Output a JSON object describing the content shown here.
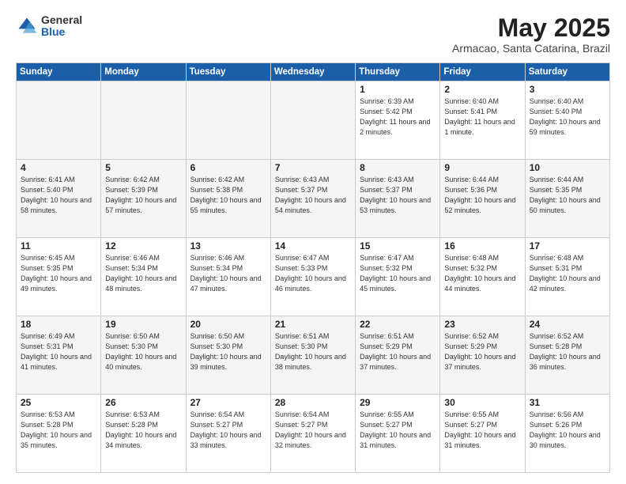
{
  "header": {
    "logo_general": "General",
    "logo_blue": "Blue",
    "month_year": "May 2025",
    "location": "Armacao, Santa Catarina, Brazil"
  },
  "days_of_week": [
    "Sunday",
    "Monday",
    "Tuesday",
    "Wednesday",
    "Thursday",
    "Friday",
    "Saturday"
  ],
  "weeks": [
    [
      {
        "day": "",
        "empty": true
      },
      {
        "day": "",
        "empty": true
      },
      {
        "day": "",
        "empty": true
      },
      {
        "day": "",
        "empty": true
      },
      {
        "day": "1",
        "sunrise": "6:39 AM",
        "sunset": "5:42 PM",
        "daylight": "11 hours and 2 minutes."
      },
      {
        "day": "2",
        "sunrise": "6:40 AM",
        "sunset": "5:41 PM",
        "daylight": "11 hours and 1 minute."
      },
      {
        "day": "3",
        "sunrise": "6:40 AM",
        "sunset": "5:40 PM",
        "daylight": "10 hours and 59 minutes."
      }
    ],
    [
      {
        "day": "4",
        "sunrise": "6:41 AM",
        "sunset": "5:40 PM",
        "daylight": "10 hours and 58 minutes."
      },
      {
        "day": "5",
        "sunrise": "6:42 AM",
        "sunset": "5:39 PM",
        "daylight": "10 hours and 57 minutes."
      },
      {
        "day": "6",
        "sunrise": "6:42 AM",
        "sunset": "5:38 PM",
        "daylight": "10 hours and 55 minutes."
      },
      {
        "day": "7",
        "sunrise": "6:43 AM",
        "sunset": "5:37 PM",
        "daylight": "10 hours and 54 minutes."
      },
      {
        "day": "8",
        "sunrise": "6:43 AM",
        "sunset": "5:37 PM",
        "daylight": "10 hours and 53 minutes."
      },
      {
        "day": "9",
        "sunrise": "6:44 AM",
        "sunset": "5:36 PM",
        "daylight": "10 hours and 52 minutes."
      },
      {
        "day": "10",
        "sunrise": "6:44 AM",
        "sunset": "5:35 PM",
        "daylight": "10 hours and 50 minutes."
      }
    ],
    [
      {
        "day": "11",
        "sunrise": "6:45 AM",
        "sunset": "5:35 PM",
        "daylight": "10 hours and 49 minutes."
      },
      {
        "day": "12",
        "sunrise": "6:46 AM",
        "sunset": "5:34 PM",
        "daylight": "10 hours and 48 minutes."
      },
      {
        "day": "13",
        "sunrise": "6:46 AM",
        "sunset": "5:34 PM",
        "daylight": "10 hours and 47 minutes."
      },
      {
        "day": "14",
        "sunrise": "6:47 AM",
        "sunset": "5:33 PM",
        "daylight": "10 hours and 46 minutes."
      },
      {
        "day": "15",
        "sunrise": "6:47 AM",
        "sunset": "5:32 PM",
        "daylight": "10 hours and 45 minutes."
      },
      {
        "day": "16",
        "sunrise": "6:48 AM",
        "sunset": "5:32 PM",
        "daylight": "10 hours and 44 minutes."
      },
      {
        "day": "17",
        "sunrise": "6:48 AM",
        "sunset": "5:31 PM",
        "daylight": "10 hours and 42 minutes."
      }
    ],
    [
      {
        "day": "18",
        "sunrise": "6:49 AM",
        "sunset": "5:31 PM",
        "daylight": "10 hours and 41 minutes."
      },
      {
        "day": "19",
        "sunrise": "6:50 AM",
        "sunset": "5:30 PM",
        "daylight": "10 hours and 40 minutes."
      },
      {
        "day": "20",
        "sunrise": "6:50 AM",
        "sunset": "5:30 PM",
        "daylight": "10 hours and 39 minutes."
      },
      {
        "day": "21",
        "sunrise": "6:51 AM",
        "sunset": "5:30 PM",
        "daylight": "10 hours and 38 minutes."
      },
      {
        "day": "22",
        "sunrise": "6:51 AM",
        "sunset": "5:29 PM",
        "daylight": "10 hours and 37 minutes."
      },
      {
        "day": "23",
        "sunrise": "6:52 AM",
        "sunset": "5:29 PM",
        "daylight": "10 hours and 37 minutes."
      },
      {
        "day": "24",
        "sunrise": "6:52 AM",
        "sunset": "5:28 PM",
        "daylight": "10 hours and 36 minutes."
      }
    ],
    [
      {
        "day": "25",
        "sunrise": "6:53 AM",
        "sunset": "5:28 PM",
        "daylight": "10 hours and 35 minutes."
      },
      {
        "day": "26",
        "sunrise": "6:53 AM",
        "sunset": "5:28 PM",
        "daylight": "10 hours and 34 minutes."
      },
      {
        "day": "27",
        "sunrise": "6:54 AM",
        "sunset": "5:27 PM",
        "daylight": "10 hours and 33 minutes."
      },
      {
        "day": "28",
        "sunrise": "6:54 AM",
        "sunset": "5:27 PM",
        "daylight": "10 hours and 32 minutes."
      },
      {
        "day": "29",
        "sunrise": "6:55 AM",
        "sunset": "5:27 PM",
        "daylight": "10 hours and 31 minutes."
      },
      {
        "day": "30",
        "sunrise": "6:55 AM",
        "sunset": "5:27 PM",
        "daylight": "10 hours and 31 minutes."
      },
      {
        "day": "31",
        "sunrise": "6:56 AM",
        "sunset": "5:26 PM",
        "daylight": "10 hours and 30 minutes."
      }
    ]
  ]
}
